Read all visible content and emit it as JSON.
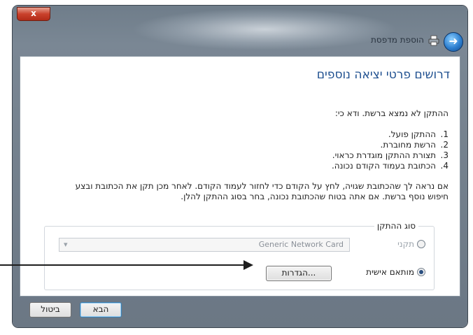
{
  "window": {
    "title": "הוספת מדפסת",
    "close_symbol": "x",
    "back_symbol": "➜"
  },
  "content": {
    "heading": "דרושים פרטי יציאה נוספים",
    "intro": "ההתקן לא נמצא ברשת. ודא כי:",
    "checks": [
      {
        "num": "1.",
        "text": "ההתקן פועל."
      },
      {
        "num": "2.",
        "text": "הרשת מחוברת."
      },
      {
        "num": "3.",
        "text": "תצורת ההתקן מוגדרת כראוי."
      },
      {
        "num": "4.",
        "text": "הכתובת בעמוד הקודם נכונה."
      }
    ],
    "instructions": "אם נראה לך שהכתובת שגויה, לחץ על הקודם כדי לחזור לעמוד הקודם. לאחר מכן תקן את הכתובת ובצע חיפוש נוסף ברשת. אם אתה בטוח שהכתובת נכונה, בחר בסוג ההתקן להלן."
  },
  "device_type": {
    "label": "סוג ההתקן",
    "standard_label": "תקני",
    "standard_value": "Generic Network Card",
    "custom_label": "מותאם אישית",
    "selected": "custom",
    "browse_label": "הגדרות..."
  },
  "footer": {
    "next_label": "הבא",
    "cancel_label": "ביטול"
  },
  "colors": {
    "heading": "#1e4f8f",
    "close_button": "#c9412c",
    "back_button": "#2d7fd0"
  },
  "icons": [
    "close-icon",
    "back-arrow-icon",
    "printer-icon",
    "dropdown-arrow-icon"
  ]
}
